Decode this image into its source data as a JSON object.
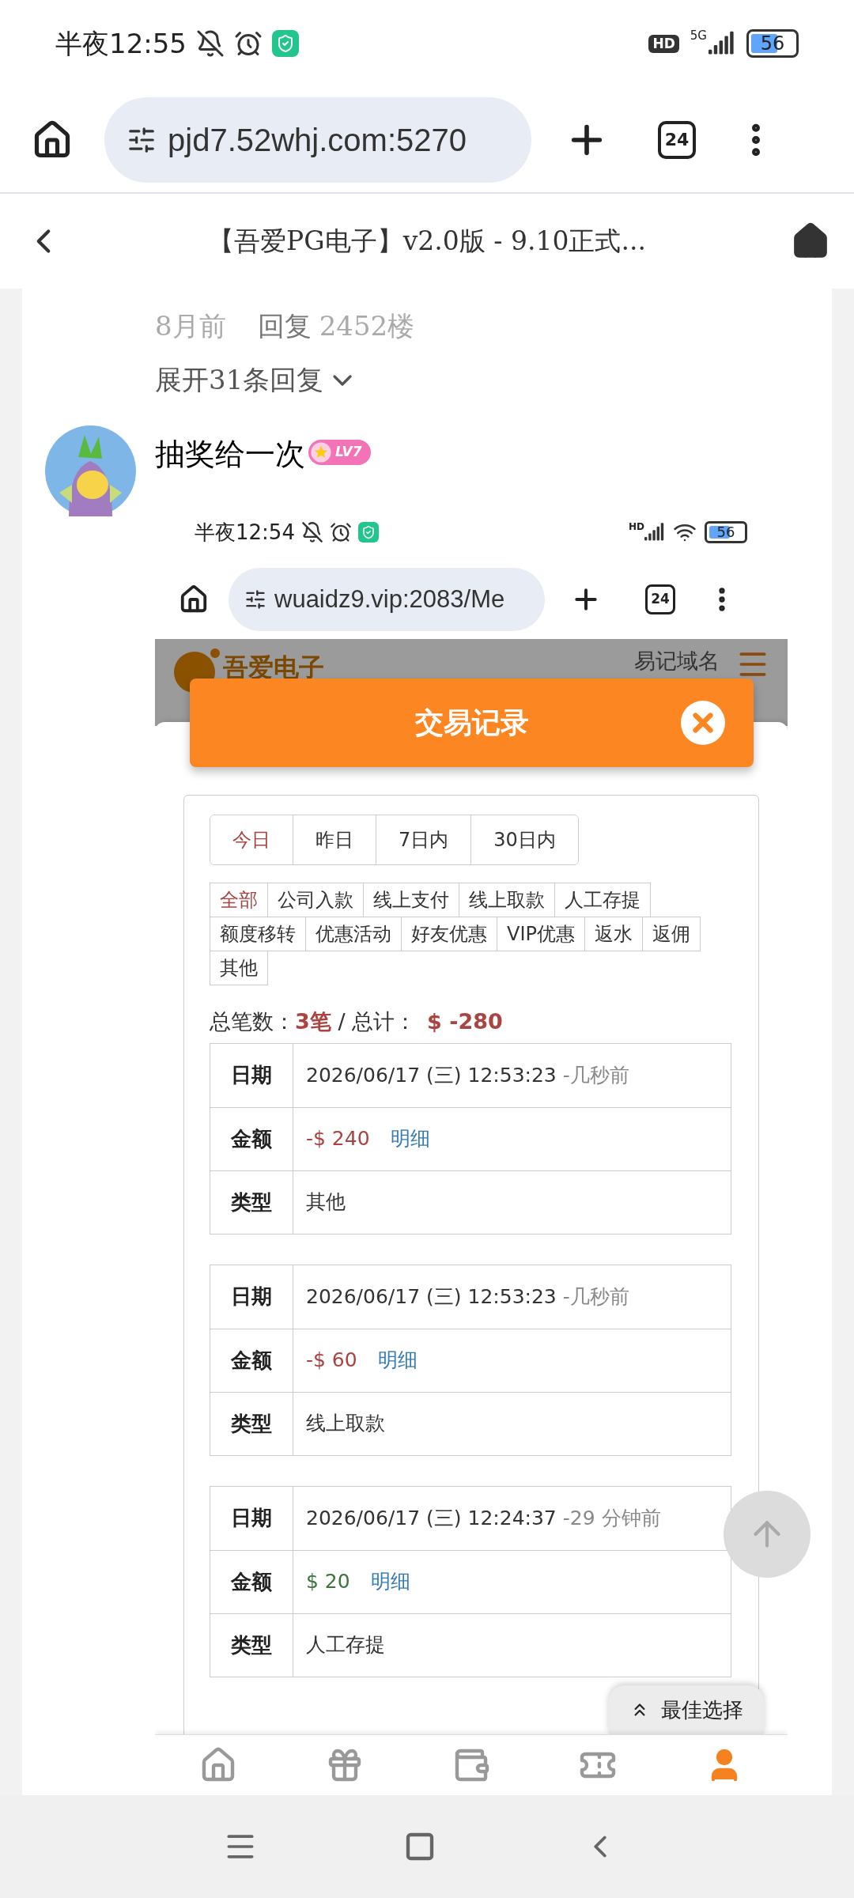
{
  "status_bar": {
    "time": "半夜12:55",
    "hd": "HD",
    "network": "5G",
    "battery": "56"
  },
  "browser": {
    "url": "pjd7.52whj.com:5270",
    "tab_count": "24"
  },
  "header": {
    "title": "【吾爱PG电子】v2.0版 - 9.10正式..."
  },
  "previous_reply": {
    "time": "8月前",
    "reply": "回复",
    "floor": "2452楼",
    "expand": "展开31条回复"
  },
  "comment": {
    "username": "抽奖给一次",
    "level": "LV7"
  },
  "screenshot": {
    "status_bar": {
      "time": "半夜12:54",
      "hd": "HD",
      "battery": "56"
    },
    "browser": {
      "url": "wuaidz9.vip:2083/Me",
      "tab_count": "24"
    },
    "site": {
      "logo": "吾爱电子",
      "link": "易记域名"
    },
    "dialog": {
      "title": "交易记录",
      "date_tabs": [
        {
          "label": "今日",
          "selected": true
        },
        {
          "label": "昨日",
          "selected": false
        },
        {
          "label": "7日内",
          "selected": false
        },
        {
          "label": "30日内",
          "selected": false
        }
      ],
      "type_tabs": [
        {
          "label": "全部",
          "selected": true
        },
        {
          "label": "公司入款",
          "selected": false
        },
        {
          "label": "线上支付",
          "selected": false
        },
        {
          "label": "线上取款",
          "selected": false
        },
        {
          "label": "人工存提",
          "selected": false
        },
        {
          "label": "额度移转",
          "selected": false
        },
        {
          "label": "优惠活动",
          "selected": false
        },
        {
          "label": "好友优惠",
          "selected": false
        },
        {
          "label": "VIP优惠",
          "selected": false
        },
        {
          "label": "返水",
          "selected": false
        },
        {
          "label": "返佣",
          "selected": false
        },
        {
          "label": "其他",
          "selected": false
        }
      ],
      "summary": {
        "count_label": "总笔数：",
        "count": "3笔",
        "total_label": " / 总计：",
        "total": "$ -280"
      },
      "records": [
        {
          "date_label": "日期",
          "date": "2026/06/17 (三) 12:53:23",
          "ago": "-几秒前",
          "amount_label": "金额",
          "amount": "-$ 240",
          "color": "#a94442",
          "detail": "明细",
          "type_label": "类型",
          "type": "其他"
        },
        {
          "date_label": "日期",
          "date": "2026/06/17 (三) 12:53:23",
          "ago": "-几秒前",
          "amount_label": "金额",
          "amount": "-$ 60",
          "color": "#a94442",
          "detail": "明细",
          "type_label": "类型",
          "type": "线上取款"
        },
        {
          "date_label": "日期",
          "date": "2026/06/17 (三) 12:24:37",
          "ago": "-29 分钟前",
          "amount_label": "金额",
          "amount": "$ 20",
          "color": "#3c763d",
          "detail": "明细",
          "type_label": "类型",
          "type": "人工存提"
        }
      ]
    },
    "best_choice": "最佳选择",
    "bottom_nav": [
      {
        "kind": "home",
        "selected": false
      },
      {
        "kind": "gift",
        "selected": false
      },
      {
        "kind": "wallet",
        "selected": false
      },
      {
        "kind": "ticket",
        "selected": false
      },
      {
        "kind": "user",
        "selected": true
      }
    ]
  }
}
